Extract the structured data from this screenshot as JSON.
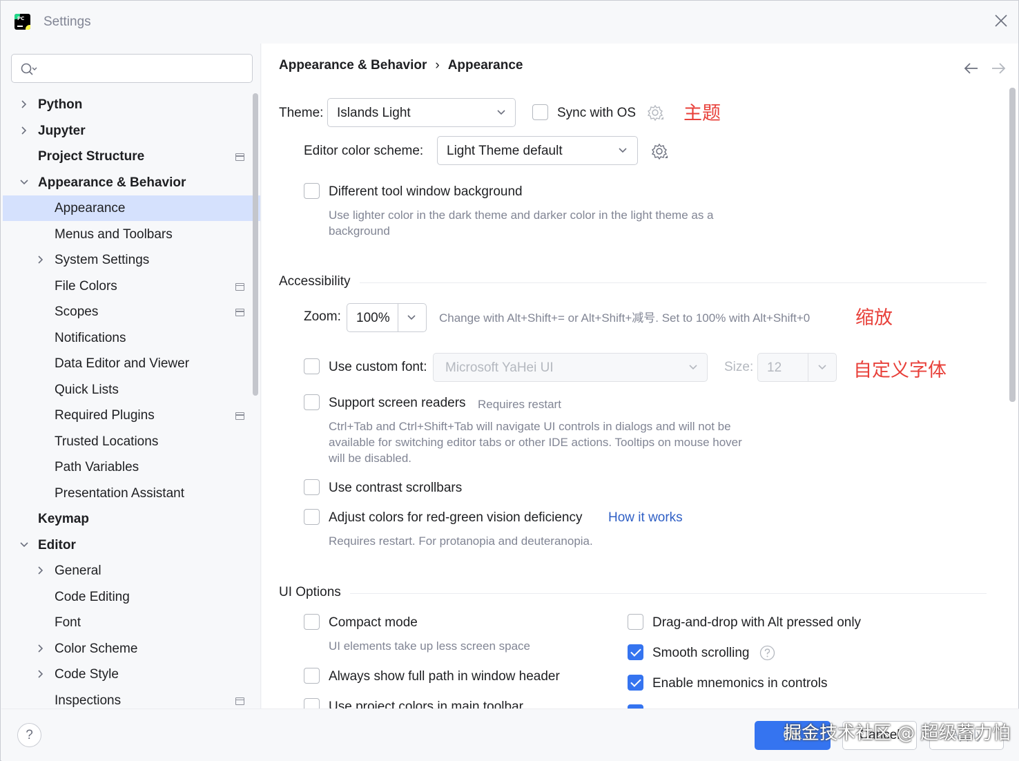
{
  "window": {
    "title": "Settings"
  },
  "sidebar": {
    "search_placeholder": "",
    "items": [
      {
        "label": "Python",
        "level": 0,
        "bold": true,
        "chevron": "right",
        "scope": false
      },
      {
        "label": "Jupyter",
        "level": 0,
        "bold": true,
        "chevron": "right",
        "scope": false
      },
      {
        "label": "Project Structure",
        "level": 0,
        "bold": true,
        "chevron": "none",
        "scope": true
      },
      {
        "label": "Appearance & Behavior",
        "level": 0,
        "bold": true,
        "chevron": "down",
        "scope": false
      },
      {
        "label": "Appearance",
        "level": 1,
        "bold": false,
        "chevron": "none",
        "scope": false,
        "selected": true
      },
      {
        "label": "Menus and Toolbars",
        "level": 1,
        "bold": false,
        "chevron": "none",
        "scope": false
      },
      {
        "label": "System Settings",
        "level": 1,
        "bold": false,
        "chevron": "right",
        "scope": false
      },
      {
        "label": "File Colors",
        "level": 1,
        "bold": false,
        "chevron": "none",
        "scope": true
      },
      {
        "label": "Scopes",
        "level": 1,
        "bold": false,
        "chevron": "none",
        "scope": true
      },
      {
        "label": "Notifications",
        "level": 1,
        "bold": false,
        "chevron": "none",
        "scope": false
      },
      {
        "label": "Data Editor and Viewer",
        "level": 1,
        "bold": false,
        "chevron": "none",
        "scope": false
      },
      {
        "label": "Quick Lists",
        "level": 1,
        "bold": false,
        "chevron": "none",
        "scope": false
      },
      {
        "label": "Required Plugins",
        "level": 1,
        "bold": false,
        "chevron": "none",
        "scope": true
      },
      {
        "label": "Trusted Locations",
        "level": 1,
        "bold": false,
        "chevron": "none",
        "scope": false
      },
      {
        "label": "Path Variables",
        "level": 1,
        "bold": false,
        "chevron": "none",
        "scope": false
      },
      {
        "label": "Presentation Assistant",
        "level": 1,
        "bold": false,
        "chevron": "none",
        "scope": false
      },
      {
        "label": "Keymap",
        "level": 0,
        "bold": true,
        "chevron": "none",
        "scope": false
      },
      {
        "label": "Editor",
        "level": 0,
        "bold": true,
        "chevron": "down",
        "scope": false
      },
      {
        "label": "General",
        "level": 1,
        "bold": false,
        "chevron": "right",
        "scope": false
      },
      {
        "label": "Code Editing",
        "level": 1,
        "bold": false,
        "chevron": "none",
        "scope": false
      },
      {
        "label": "Font",
        "level": 1,
        "bold": false,
        "chevron": "none",
        "scope": false
      },
      {
        "label": "Color Scheme",
        "level": 1,
        "bold": false,
        "chevron": "right",
        "scope": false
      },
      {
        "label": "Code Style",
        "level": 1,
        "bold": false,
        "chevron": "right",
        "scope": false
      },
      {
        "label": "Inspections",
        "level": 1,
        "bold": false,
        "chevron": "none",
        "scope": true
      }
    ]
  },
  "breadcrumb": {
    "parent": "Appearance & Behavior",
    "separator": "›",
    "current": "Appearance"
  },
  "theme": {
    "label": "Theme:",
    "value": "Islands Light",
    "sync_label": "Sync with OS",
    "sync_checked": false,
    "annotation": "主题"
  },
  "editor_scheme": {
    "label": "Editor color scheme:",
    "value": "Light Theme default"
  },
  "tool_window_bg": {
    "label": "Different tool window background",
    "checked": false,
    "hint_line1": "Use lighter color in the dark theme and darker color in the light theme as a",
    "hint_line2": "background"
  },
  "accessibility": {
    "title": "Accessibility",
    "zoom_label": "Zoom:",
    "zoom_value": "100%",
    "zoom_hint": "Change with Alt+Shift+= or Alt+Shift+减号. Set to 100% with Alt+Shift+0",
    "zoom_annotation": "缩放",
    "custom_font_label": "Use custom font:",
    "custom_font_checked": false,
    "custom_font_value": "Microsoft YaHei UI",
    "size_label": "Size:",
    "size_value": "12",
    "font_annotation": "自定义字体",
    "screen_readers_label": "Support screen readers",
    "screen_readers_checked": false,
    "screen_readers_restart": "Requires restart",
    "screen_readers_hint_line1": "Ctrl+Tab and Ctrl+Shift+Tab will navigate UI controls in dialogs and will not be",
    "screen_readers_hint_line2": "available for switching editor tabs or other IDE actions. Tooltips on mouse hover",
    "screen_readers_hint_line3": "will be disabled.",
    "contrast_label": "Use contrast scrollbars",
    "contrast_checked": false,
    "color_deficiency_label": "Adjust colors for red-green vision deficiency",
    "color_deficiency_checked": false,
    "how_it_works": "How it works",
    "color_deficiency_hint": "Requires restart. For protanopia and deuteranopia."
  },
  "ui_options": {
    "title": "UI Options",
    "compact_label": "Compact mode",
    "compact_checked": false,
    "compact_hint": "UI elements take up less screen space",
    "full_path_label": "Always show full path in window header",
    "full_path_checked": false,
    "project_colors_label": "Use project colors in main toolbar",
    "project_colors_checked": false,
    "drag_drop_label": "Drag-and-drop with Alt pressed only",
    "drag_drop_checked": false,
    "smooth_label": "Smooth scrolling",
    "smooth_checked": true,
    "mnemonics_label": "Enable mnemonics in controls",
    "mnemonics_checked": true,
    "next_checked": true
  },
  "buttons": {
    "help": "?",
    "ok": "OK",
    "cancel": "Cancel",
    "apply": "Apply"
  },
  "watermark": "掘金技术社区 @ 超级蓄力怕",
  "colors": {
    "accent": "#3574f0",
    "selection": "#d5e1fd",
    "annotation_red": "#e8403a",
    "link": "#2f5fc5"
  }
}
